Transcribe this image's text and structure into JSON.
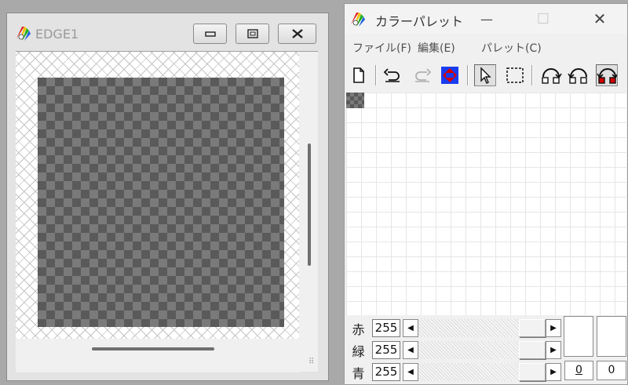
{
  "edge_window": {
    "title": "EDGE1",
    "icons": {
      "app": "palette-app-icon",
      "minimize": "minimize-icon",
      "maximize": "maximize-icon",
      "close": "close-icon"
    }
  },
  "palette_window": {
    "title": "カラーパレット",
    "caption_buttons": {
      "minimize": "—",
      "maximize": "☐",
      "close": "✕"
    },
    "menu": [
      "ファイル(F)",
      "編集(E)",
      "パレット(C)"
    ],
    "toolbar": [
      "new-icon",
      "undo-icon",
      "redo-icon",
      "swap-color-icon",
      "pointer-icon",
      "select-rect-icon",
      "pick-icon",
      "pick-add-icon",
      "pick-replace-icon"
    ],
    "sliders": [
      {
        "label": "赤",
        "value": "255"
      },
      {
        "label": "緑",
        "value": "255"
      },
      {
        "label": "青",
        "value": "255"
      }
    ],
    "preview_values": [
      "0",
      "0"
    ],
    "colors": {
      "accent_red": "#d40000",
      "accent_blue": "#1a3cf0"
    }
  }
}
